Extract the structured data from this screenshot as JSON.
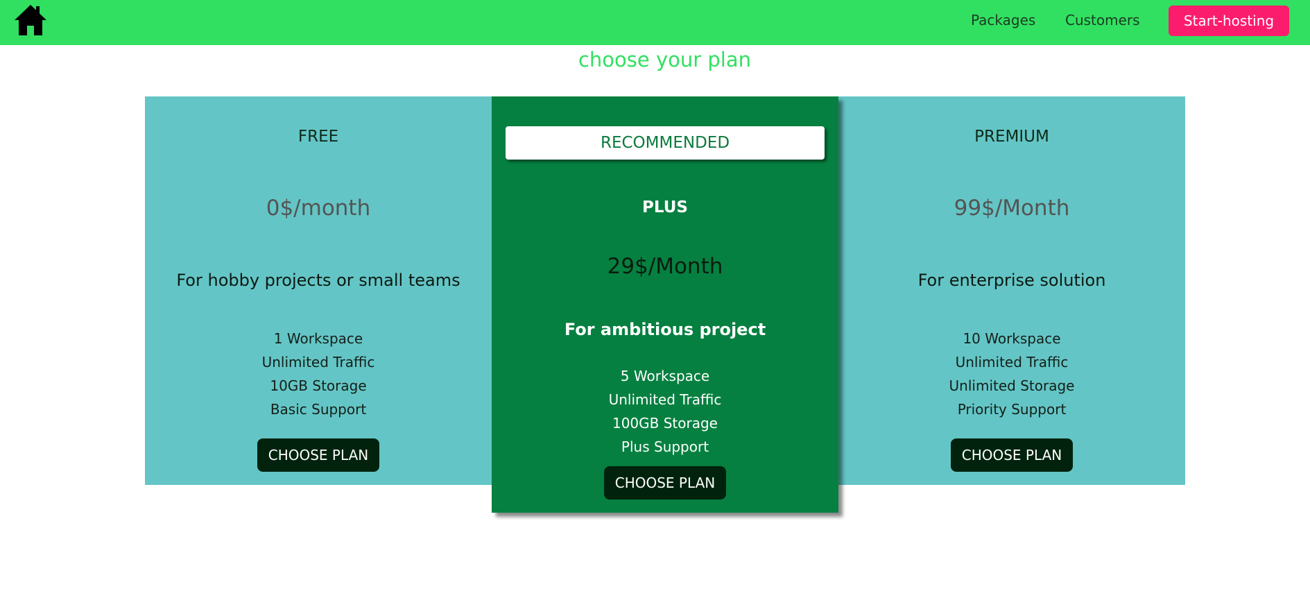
{
  "nav": {
    "home_icon": "home-icon",
    "links": [
      "Packages",
      "Customers"
    ],
    "cta_label": "Start-hosting"
  },
  "page": {
    "title": "choose your plan"
  },
  "plans": [
    {
      "name": "FREE",
      "price": "0$/month",
      "tagline": "For hobby projects or small teams",
      "features": [
        "1 Workspace",
        "Unlimited Traffic",
        "10GB Storage",
        "Basic Support"
      ],
      "button": "CHOOSE PLAN"
    },
    {
      "badge": "RECOMMENDED",
      "name": "PLUS",
      "price": "29$/Month",
      "tagline": "For ambitious project",
      "features": [
        "5 Workspace",
        "Unlimited Traffic",
        "100GB Storage",
        "Plus Support"
      ],
      "button": "CHOOSE PLAN"
    },
    {
      "name": "PREMIUM",
      "price": "99$/Month",
      "tagline": "For enterprise solution",
      "features": [
        "10 Workspace",
        "Unlimited Traffic",
        "Unlimited Storage",
        "Priority Support"
      ],
      "button": "CHOOSE PLAN"
    }
  ],
  "colors": {
    "navbar": "#31e060",
    "cta": "#fc1c6e",
    "card_side": "#64c5c6",
    "card_recommended": "#068040",
    "button": "#01230d"
  }
}
